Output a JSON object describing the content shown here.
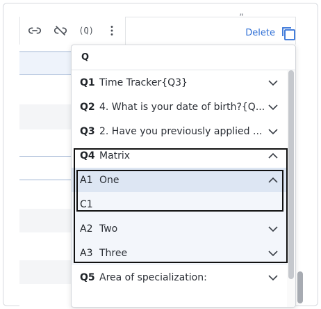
{
  "toolbar": {
    "link_icon": "link-icon",
    "unlink_icon": "unlink-icon",
    "piped_text_label": "(Q)",
    "more_icon": "more-vertical-icon"
  },
  "top": {
    "delete_label": "Delete",
    "quote_mark": "”"
  },
  "dropdown": {
    "search_value": "Q",
    "items": [
      {
        "code": "Q1",
        "label": "Time Tracker{Q3}",
        "expanded": false
      },
      {
        "code": "Q2",
        "label": "4. What is your date of birth?{Q...",
        "expanded": false
      },
      {
        "code": "Q3",
        "label": "2. Have you previously applied ...",
        "expanded": false
      },
      {
        "code": "Q4",
        "label": "Matrix",
        "expanded": true
      },
      {
        "code": "A1",
        "label": "One",
        "expanded": true
      },
      {
        "code": "C1",
        "label": "",
        "expanded": false
      },
      {
        "code": "A2",
        "label": "Two",
        "expanded": false
      },
      {
        "code": "A3",
        "label": "Three",
        "expanded": false
      },
      {
        "code": "Q5",
        "label": "Area of specialization:",
        "expanded": false
      }
    ]
  },
  "colors": {
    "accent": "#2f6fd6",
    "selected_row": "#dde6f3",
    "sub_row": "#f3f6fb"
  }
}
